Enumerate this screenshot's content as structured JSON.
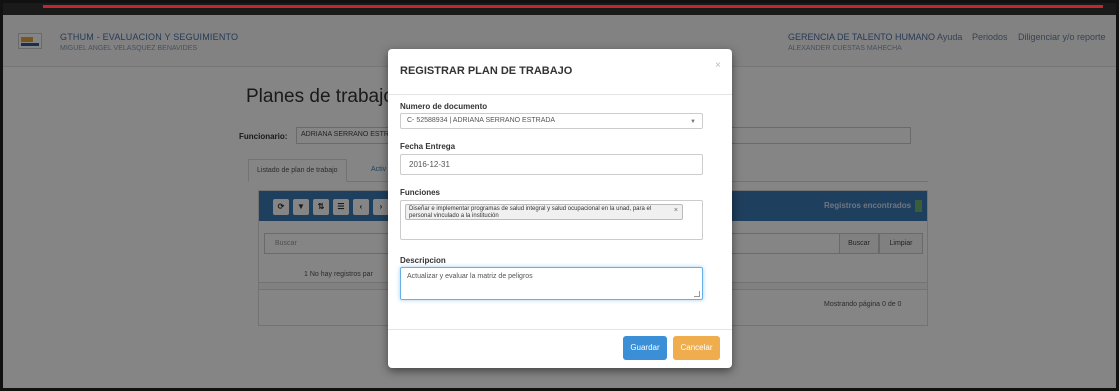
{
  "header": {
    "app_title": "GTHUM - EVALUACION Y SEGUIMIENTO",
    "app_user": "MIGUEL ANGEL VELASQUEZ BENAVIDES",
    "org_title": "GERENCIA DE TALENTO HUMANO",
    "org_user": "ALEXANDER CUESTAS MAHECHA",
    "nav": [
      "Ayuda",
      "Periodos",
      "Diligenciar y/o reporte"
    ]
  },
  "page": {
    "title": "Planes de trabajo",
    "funcionario_label": "Funcionario:",
    "funcionario_value": "ADRIANA SERRANO ESTRADA",
    "tabs": [
      "Listado de plan de trabajo",
      "Activ"
    ],
    "toolbar_icons": [
      "refresh-icon",
      "filter-icon",
      "sort-icon",
      "list-icon",
      "prev-icon",
      "next-icon"
    ],
    "registros": "Registros encontrados",
    "search_placeholder": "Buscar",
    "buscar": "Buscar",
    "limpiar": "Limpiar",
    "no_records": "1  No hay registros par",
    "mostrando": "Mostrando página 0 de 0"
  },
  "modal": {
    "title": "REGISTRAR PLAN DE TRABAJO",
    "close": "×",
    "numero_label": "Numero de documento",
    "numero_value": "C- 52588934 | ADRIANA SERRANO ESTRADA",
    "fecha_label": "Fecha Entrega",
    "fecha_value": "2016-12-31",
    "funciones_label": "Funciones",
    "funciones_tag": "Diseñar e implementar programas de salud integral y salud ocupacional en la unad, para el personal vinculado a la institución",
    "descripcion_label": "Descripcion",
    "descripcion_value": "Actualizar y evaluar la matriz de peligros",
    "save": "Guardar",
    "cancel": "Cancelar"
  }
}
